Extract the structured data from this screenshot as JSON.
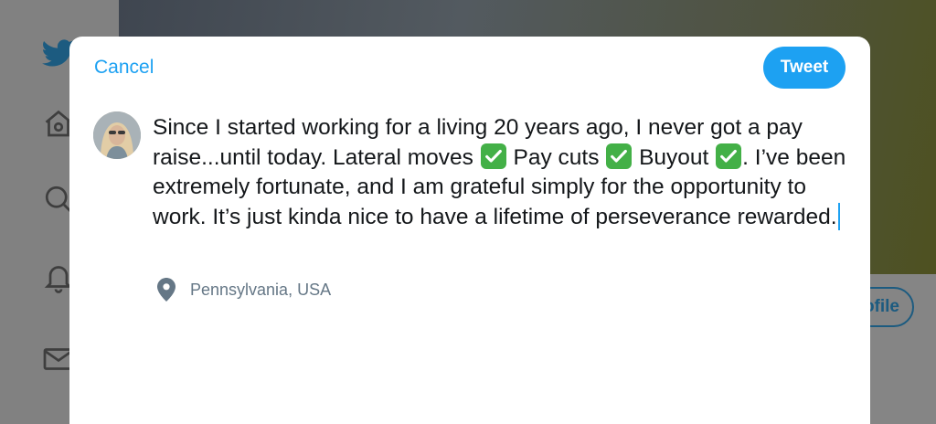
{
  "background": {
    "profile_button_label": "ofile",
    "sidebar_icons": [
      "twitter-bird-icon",
      "home-icon",
      "search-icon",
      "bell-icon",
      "mail-icon"
    ]
  },
  "compose": {
    "cancel_label": "Cancel",
    "tweet_label": "Tweet",
    "text": {
      "part1": "Since I started working for a living 20 years ago, I never got a pay raise...until today. Lateral moves ",
      "part2": " Pay cuts ",
      "part3": " Buyout ",
      "part4": ". I’ve been extremely fortunate, and I am grateful simply for the opportunity to work. It’s just kinda nice to have a lifetime of perseverance rewarded."
    },
    "location": "Pennsylvania, USA",
    "check_emoji": "white-heavy-check-mark-icon"
  },
  "colors": {
    "accent": "#1da1f2",
    "text": "#14171a",
    "secondary_text": "#657786",
    "check_green": "#43b047"
  }
}
